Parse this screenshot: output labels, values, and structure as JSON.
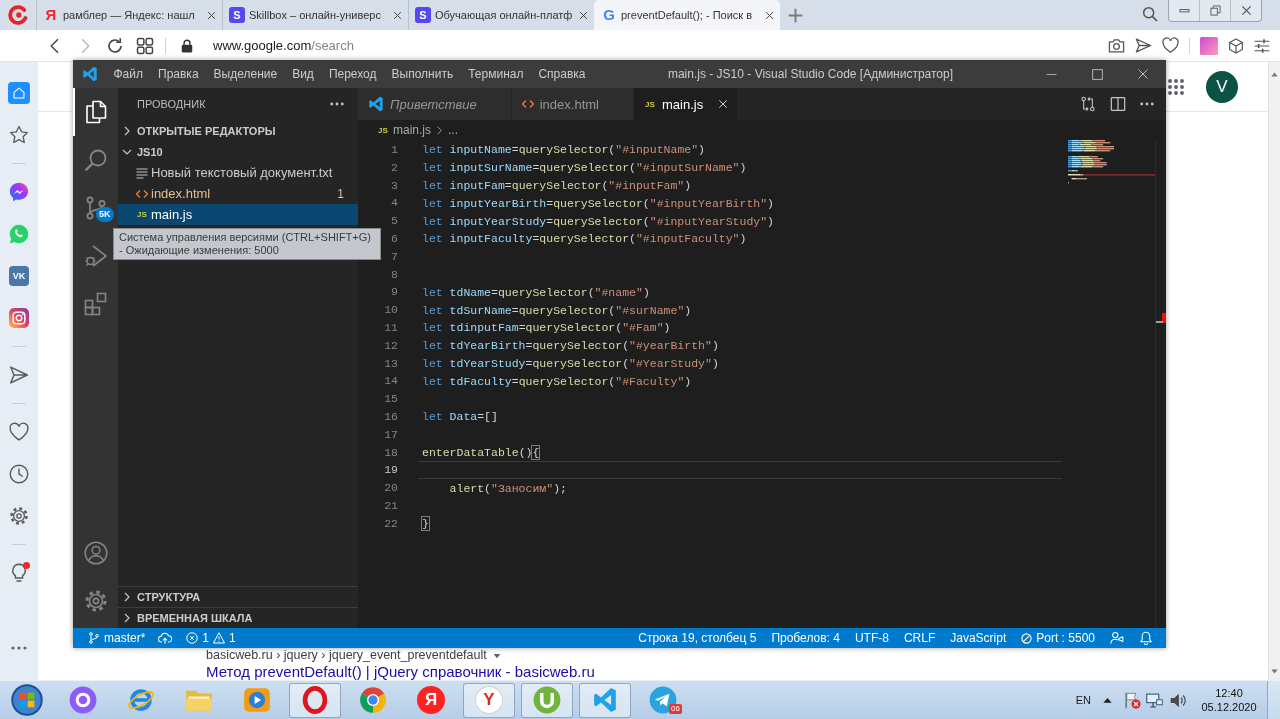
{
  "browser": {
    "tabs": [
      {
        "favicon": {
          "kind": "glyph",
          "text": "Я"
        },
        "title": "рамблер — Яндекс: нашл",
        "selected": false
      },
      {
        "favicon": {
          "kind": "tile",
          "text": "S"
        },
        "title": "Skillbox – онлайн-универс",
        "selected": false
      },
      {
        "favicon": {
          "kind": "tile",
          "text": "S"
        },
        "title": "Обучающая онлайн-платф",
        "selected": false
      },
      {
        "favicon": {
          "kind": "google",
          "text": "G"
        },
        "title": "preventDefault(); - Поиск в",
        "selected": true
      }
    ],
    "address": {
      "host": "www.google.com",
      "path": "/search"
    },
    "sidebar_groups": [
      [
        {
          "kind": "home",
          "selected": true,
          "notification": false
        },
        {
          "kind": "bookmarks",
          "selected": false,
          "notification": false
        }
      ],
      [
        {
          "kind": "messenger",
          "selected": false,
          "notification": false
        },
        {
          "kind": "whatsapp",
          "selected": false,
          "notification": false
        },
        {
          "kind": "vk",
          "text": "VK",
          "selected": false,
          "notification": false
        },
        {
          "kind": "instagram",
          "selected": false,
          "notification": false
        }
      ],
      [
        {
          "kind": "send",
          "selected": false,
          "notification": false
        }
      ],
      [
        {
          "kind": "favorites",
          "selected": false,
          "notification": false
        },
        {
          "kind": "history",
          "selected": false,
          "notification": false
        },
        {
          "kind": "settings",
          "selected": false,
          "notification": false
        }
      ],
      [
        {
          "kind": "tips",
          "selected": false,
          "notification": true
        }
      ]
    ]
  },
  "page": {
    "avatar": "V",
    "breadcrumb": "basicweb.ru › jquery › jquery_event_preventdefault",
    "result_title": "Метод preventDefault() | jQuery справочник - basicweb.ru"
  },
  "vscode": {
    "menu": [
      "Файл",
      "Правка",
      "Выделение",
      "Вид",
      "Переход",
      "Выполнить",
      "Терминал",
      "Справка"
    ],
    "title": "main.js - JS10 - Visual Studio Code [Администратор]",
    "activity_bar": [
      {
        "kind": "explorer",
        "selected": true
      },
      {
        "kind": "search",
        "selected": false
      },
      {
        "kind": "scm",
        "selected": false,
        "badge": "5K"
      },
      {
        "kind": "debug",
        "selected": false
      },
      {
        "kind": "extensions",
        "selected": false
      }
    ],
    "activity_bottom": [
      {
        "kind": "accounts"
      },
      {
        "kind": "manage"
      }
    ],
    "explorer": {
      "title": "ПРОВОДНИК",
      "sections": [
        {
          "label": "ОТКРЫТЫЕ РЕДАКТОРЫ",
          "expanded": false
        },
        {
          "label": "JS10",
          "expanded": true,
          "files": [
            {
              "kind": "text",
              "name": "Новый текстовый документ.txt",
              "selected": false
            },
            {
              "kind": "html",
              "name": "index.html",
              "problems": "1",
              "selected": false
            },
            {
              "kind": "js",
              "icon": "JS",
              "name": "main.js",
              "selected": true
            }
          ]
        }
      ],
      "bottom_sections": [
        {
          "label": "СТРУКТУРА",
          "expanded": false
        },
        {
          "label": "ВРЕМЕННАЯ ШКАЛА",
          "expanded": false
        }
      ]
    },
    "tabs": [
      {
        "kind": "welcome",
        "label": "Приветствие",
        "selected": false
      },
      {
        "kind": "html",
        "label": "index.html",
        "selected": false
      },
      {
        "kind": "js",
        "icon": "JS",
        "label": "main.js",
        "selected": true
      }
    ],
    "breadcrumb": {
      "icon": "JS",
      "file": "main.js",
      "rest": "..."
    },
    "code": [
      {
        "number": "1",
        "current": false,
        "tokens": [
          {
            "kind": "keyword",
            "text": "let "
          },
          {
            "kind": "variable",
            "text": "inputName"
          },
          {
            "kind": "punct",
            "text": "="
          },
          {
            "kind": "function",
            "text": "querySelector"
          },
          {
            "kind": "punct",
            "text": "("
          },
          {
            "kind": "string",
            "text": "\"#inputName\""
          },
          {
            "kind": "punct",
            "text": ")"
          }
        ]
      },
      {
        "number": "2",
        "current": false,
        "tokens": [
          {
            "kind": "keyword",
            "text": "let "
          },
          {
            "kind": "variable",
            "text": "inputSurName"
          },
          {
            "kind": "punct",
            "text": "="
          },
          {
            "kind": "function",
            "text": "querySelector"
          },
          {
            "kind": "punct",
            "text": "("
          },
          {
            "kind": "string",
            "text": "\"#inputSurName\""
          },
          {
            "kind": "punct",
            "text": ")"
          }
        ]
      },
      {
        "number": "3",
        "current": false,
        "tokens": [
          {
            "kind": "keyword",
            "text": "let "
          },
          {
            "kind": "variable",
            "text": "inputFam"
          },
          {
            "kind": "punct",
            "text": "="
          },
          {
            "kind": "function",
            "text": "querySelector"
          },
          {
            "kind": "punct",
            "text": "("
          },
          {
            "kind": "string",
            "text": "\"#inputFam\""
          },
          {
            "kind": "punct",
            "text": ")"
          }
        ]
      },
      {
        "number": "4",
        "current": false,
        "tokens": [
          {
            "kind": "keyword",
            "text": "let "
          },
          {
            "kind": "variable",
            "text": "inputYearBirth"
          },
          {
            "kind": "punct",
            "text": "="
          },
          {
            "kind": "function",
            "text": "querySelector"
          },
          {
            "kind": "punct",
            "text": "("
          },
          {
            "kind": "string",
            "text": "\"#inputYearBirth\""
          },
          {
            "kind": "punct",
            "text": ")"
          }
        ]
      },
      {
        "number": "5",
        "current": false,
        "tokens": [
          {
            "kind": "keyword",
            "text": "let "
          },
          {
            "kind": "variable",
            "text": "inputYearStudy"
          },
          {
            "kind": "punct",
            "text": "="
          },
          {
            "kind": "function",
            "text": "querySelector"
          },
          {
            "kind": "punct",
            "text": "("
          },
          {
            "kind": "string",
            "text": "\"#inputYearStudy\""
          },
          {
            "kind": "punct",
            "text": ")"
          }
        ]
      },
      {
        "number": "6",
        "current": false,
        "tokens": [
          {
            "kind": "keyword",
            "text": "let "
          },
          {
            "kind": "variable",
            "text": "inputFaculty"
          },
          {
            "kind": "punct",
            "text": "="
          },
          {
            "kind": "function",
            "text": "querySelector"
          },
          {
            "kind": "punct",
            "text": "("
          },
          {
            "kind": "string",
            "text": "\"#inputFaculty\""
          },
          {
            "kind": "punct",
            "text": ")"
          }
        ]
      },
      {
        "number": "7",
        "current": false
      },
      {
        "number": "8",
        "current": false
      },
      {
        "number": "9",
        "current": false,
        "tokens": [
          {
            "kind": "keyword",
            "text": "let "
          },
          {
            "kind": "variable",
            "text": "tdName"
          },
          {
            "kind": "punct",
            "text": "="
          },
          {
            "kind": "function",
            "text": "querySelector"
          },
          {
            "kind": "punct",
            "text": "("
          },
          {
            "kind": "string",
            "text": "\"#name\""
          },
          {
            "kind": "punct",
            "text": ")"
          }
        ]
      },
      {
        "number": "10",
        "current": false,
        "tokens": [
          {
            "kind": "keyword",
            "text": "let "
          },
          {
            "kind": "variable",
            "text": "tdSurName"
          },
          {
            "kind": "punct",
            "text": "="
          },
          {
            "kind": "function",
            "text": "querySelector"
          },
          {
            "kind": "punct",
            "text": "("
          },
          {
            "kind": "string",
            "text": "\"#surName\""
          },
          {
            "kind": "punct",
            "text": ")"
          }
        ]
      },
      {
        "number": "11",
        "current": false,
        "tokens": [
          {
            "kind": "keyword",
            "text": "let "
          },
          {
            "kind": "variable",
            "text": "tdinputFam"
          },
          {
            "kind": "punct",
            "text": "="
          },
          {
            "kind": "function",
            "text": "querySelector"
          },
          {
            "kind": "punct",
            "text": "("
          },
          {
            "kind": "string",
            "text": "\"#Fam\""
          },
          {
            "kind": "punct",
            "text": ")"
          }
        ]
      },
      {
        "number": "12",
        "current": false,
        "tokens": [
          {
            "kind": "keyword",
            "text": "let "
          },
          {
            "kind": "variable",
            "text": "tdYearBirth"
          },
          {
            "kind": "punct",
            "text": "="
          },
          {
            "kind": "function",
            "text": "querySelector"
          },
          {
            "kind": "punct",
            "text": "("
          },
          {
            "kind": "string",
            "text": "\"#yearBirth\""
          },
          {
            "kind": "punct",
            "text": ")"
          }
        ]
      },
      {
        "number": "13",
        "current": false,
        "tokens": [
          {
            "kind": "keyword",
            "text": "let "
          },
          {
            "kind": "variable",
            "text": "tdYearStudy"
          },
          {
            "kind": "punct",
            "text": "="
          },
          {
            "kind": "function",
            "text": "querySelector"
          },
          {
            "kind": "punct",
            "text": "("
          },
          {
            "kind": "string",
            "text": "\"#YearStudy\""
          },
          {
            "kind": "punct",
            "text": ")"
          }
        ]
      },
      {
        "number": "14",
        "current": false,
        "tokens": [
          {
            "kind": "keyword",
            "text": "let "
          },
          {
            "kind": "variable",
            "text": "tdFaculty"
          },
          {
            "kind": "punct",
            "text": "="
          },
          {
            "kind": "function",
            "text": "querySelector"
          },
          {
            "kind": "punct",
            "text": "("
          },
          {
            "kind": "string",
            "text": "\"#Faculty\""
          },
          {
            "kind": "punct",
            "text": ")"
          }
        ]
      },
      {
        "number": "15",
        "current": false
      },
      {
        "number": "16",
        "current": false,
        "tokens": [
          {
            "kind": "keyword",
            "text": "let "
          },
          {
            "kind": "variable",
            "text": "Data"
          },
          {
            "kind": "punct",
            "text": "=[]"
          }
        ]
      },
      {
        "number": "17",
        "current": false
      },
      {
        "number": "18",
        "current": false,
        "tokens": [
          {
            "kind": "function",
            "text": "enterDataTable"
          },
          {
            "kind": "punct",
            "text": "()"
          },
          {
            "kind": "brace",
            "text": "{"
          }
        ]
      },
      {
        "number": "19",
        "current": true
      },
      {
        "number": "20",
        "current": false,
        "indent": true,
        "tokens": [
          {
            "kind": "function",
            "text": "alert"
          },
          {
            "kind": "punct",
            "text": "("
          },
          {
            "kind": "string",
            "text": "\"Заносим\""
          },
          {
            "kind": "punct",
            "text": ");"
          }
        ]
      },
      {
        "number": "21",
        "current": false
      },
      {
        "number": "22",
        "current": false,
        "tokens": [
          {
            "kind": "brace",
            "text": "}"
          }
        ]
      }
    ],
    "tooltip": "Система управления версиями (CTRL+SHIFT+G) - Ожидающие изменения: 5000",
    "status_bar": {
      "branch": "master*",
      "errors": "1",
      "warnings": "1",
      "items": [
        {
          "kind": "text",
          "text": "Строка 19, столбец 5"
        },
        {
          "kind": "text",
          "text": "Пробелов: 4"
        },
        {
          "kind": "text",
          "text": "UTF-8"
        },
        {
          "kind": "text",
          "text": "CRLF"
        },
        {
          "kind": "text",
          "text": "JavaScript"
        },
        {
          "kind": "port",
          "text": "Port : 5500"
        }
      ]
    }
  },
  "taskbar": {
    "apps": [
      {
        "kind": "alice",
        "running": false
      },
      {
        "kind": "ie",
        "running": false
      },
      {
        "kind": "folder",
        "running": false
      },
      {
        "kind": "player",
        "running": false
      },
      {
        "kind": "opera",
        "running": true
      },
      {
        "kind": "chrome",
        "running": false
      },
      {
        "kind": "yandex",
        "text": "Я",
        "running": false
      },
      {
        "kind": "ybrowser",
        "text": "Y",
        "running": true
      },
      {
        "kind": "torrent",
        "running": true
      },
      {
        "kind": "vscode",
        "running": true
      },
      {
        "kind": "telegram",
        "badge": "06",
        "running": false
      }
    ],
    "language": "EN",
    "time": "12:40",
    "date": "05.12.2020"
  }
}
